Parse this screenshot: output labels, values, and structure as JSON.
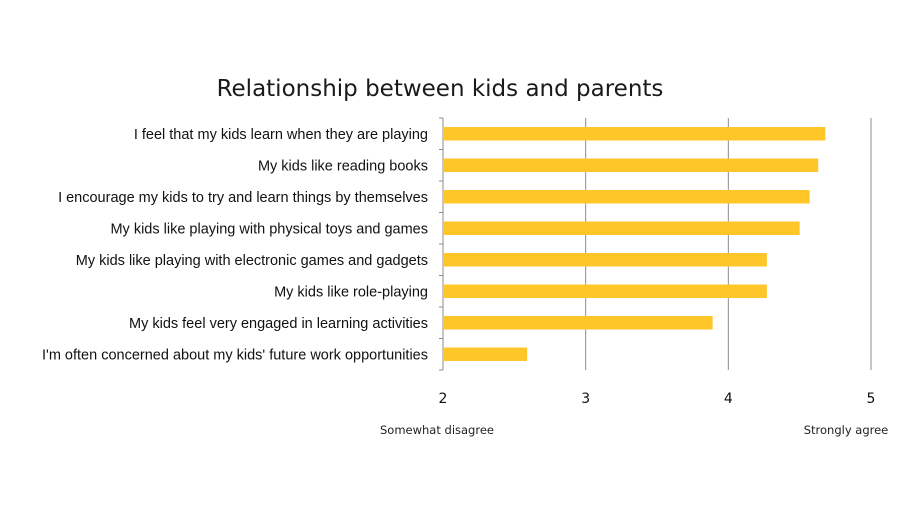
{
  "chart_data": {
    "type": "bar",
    "orientation": "horizontal",
    "title": "Relationship between kids and parents",
    "categories": [
      "I feel that my kids learn when they are playing",
      "My kids like reading books",
      "I encourage my kids to try and learn things by themselves",
      "My kids like playing with physical toys and games",
      "My kids like playing with electronic games and gadgets",
      "My kids like role-playing",
      "My kids feel very engaged in learning activities",
      "I'm often concerned about my kids' future work opportunities"
    ],
    "values": [
      4.68,
      4.63,
      4.57,
      4.5,
      4.27,
      4.27,
      3.89,
      2.59
    ],
    "xlim": [
      2,
      5
    ],
    "xticks": [
      "2",
      "3",
      "4",
      "5"
    ],
    "x_anchor_low": "Somewhat disagree",
    "x_anchor_high": "Strongly agree",
    "grid": "vertical",
    "legend": "none",
    "bar_color": "#FFC629",
    "axis_color": "#8C8C8C"
  }
}
